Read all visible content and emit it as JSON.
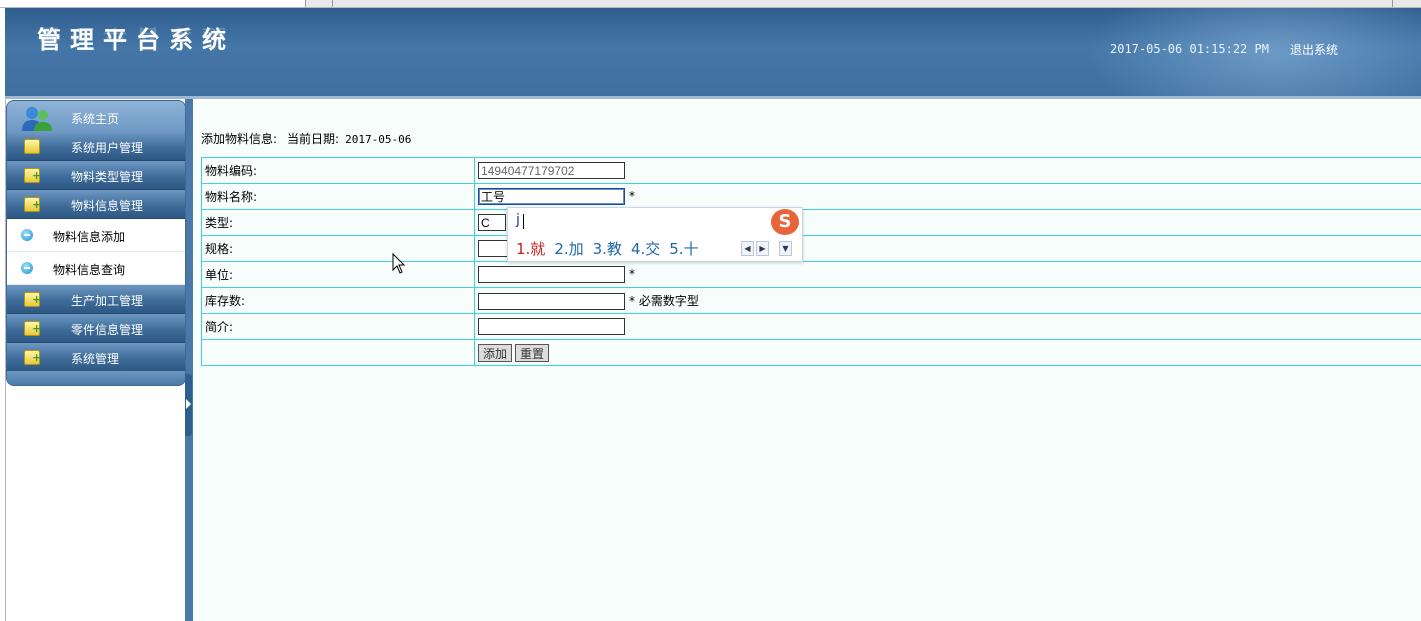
{
  "header": {
    "title": "管理平台系统",
    "datetime": "2017-05-06 01:15:22 PM",
    "logout_label": "退出系统"
  },
  "sidebar": {
    "home_label": "系统主页",
    "items": [
      {
        "label": "系统用户管理",
        "icon": "folder-icon"
      },
      {
        "label": "物料类型管理",
        "icon": "folder-add-icon"
      },
      {
        "label": "物料信息管理",
        "icon": "folder-add-icon"
      }
    ],
    "sub_items": [
      {
        "label": "物料信息添加",
        "icon": "arrow-circle-icon"
      },
      {
        "label": "物料信息查询",
        "icon": "arrow-circle-icon"
      }
    ],
    "items_after": [
      {
        "label": "生产加工管理",
        "icon": "folder-add-icon"
      },
      {
        "label": "零件信息管理",
        "icon": "folder-add-icon"
      },
      {
        "label": "系统管理",
        "icon": "folder-add-icon"
      }
    ]
  },
  "form": {
    "heading": "添加物料信息:",
    "date_label": "当前日期:",
    "date_value": "2017-05-06",
    "fields": {
      "code": {
        "label": "物料编码:",
        "value": "14940477179702"
      },
      "name": {
        "label": "物料名称:",
        "value": "工号",
        "required": "*"
      },
      "type": {
        "label": "类型:",
        "value": "C"
      },
      "spec": {
        "label": "规格:",
        "value": ""
      },
      "unit": {
        "label": "单位:",
        "value": "",
        "required": "*"
      },
      "stock": {
        "label": "库存数:",
        "value": "",
        "required": "*",
        "hint": "必需数字型"
      },
      "intro": {
        "label": "简介:",
        "value": ""
      }
    },
    "add_button": "添加",
    "reset_button": "重置"
  },
  "ime": {
    "composition": "j",
    "logo": "S",
    "candidates": [
      "1.就",
      "2.加",
      "3.教",
      "4.交",
      "5.十"
    ]
  }
}
